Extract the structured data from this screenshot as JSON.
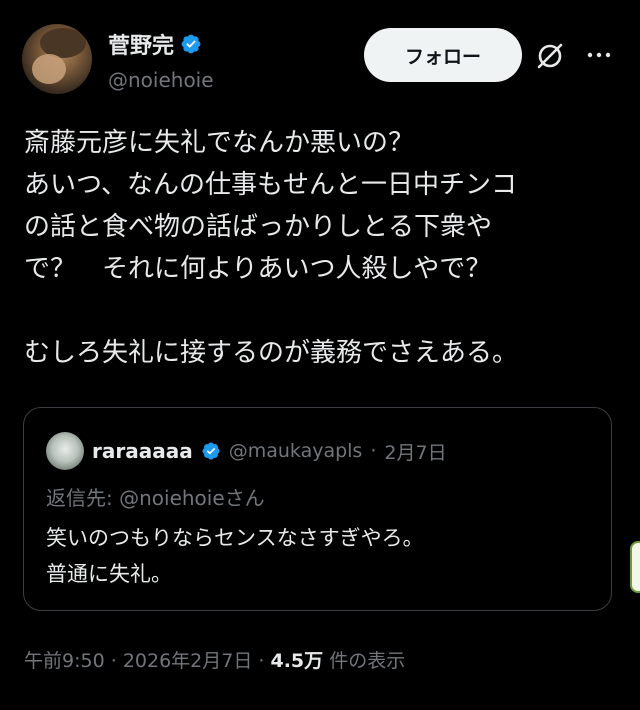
{
  "author": {
    "display_name": "菅野完",
    "handle": "@noiehoie",
    "verified": true,
    "avatar_icon": "user-avatar"
  },
  "actions": {
    "follow_label": "フォロー",
    "grok_icon": "grok-icon",
    "more_icon": "more-options-icon"
  },
  "tweet": {
    "lines": [
      "斎藤元彦に失礼でなんか悪いの？",
      "あいつ、なんの仕事もせんと一日中チンコ",
      "の話と食べ物の話ばっかりしとる下衆や",
      "で？　それに何よりあいつ人殺しやで？",
      "",
      "むしろ失礼に接するのが義務でさえある。"
    ]
  },
  "quote": {
    "display_name": "raraaaaa",
    "handle": "@maukayapls",
    "separator": "·",
    "date": "2月7日",
    "reply_to_prefix": "返信先: ",
    "reply_to_handle": "@noiehoie",
    "reply_to_suffix": "さん",
    "lines": [
      "笑いのつもりならセンスなさすぎやろ。",
      "普通に失礼。"
    ]
  },
  "meta": {
    "time": "午前9:50",
    "separator": "·",
    "date": "2026年2月7日",
    "views_count": "4.5万",
    "views_label": "件の表示"
  },
  "colors": {
    "background": "#000000",
    "text": "#e7e9ea",
    "secondary": "#71767b",
    "verified_blue": "#1d9bf0",
    "follow_bg": "#eff3f4",
    "border": "#3a3e42"
  }
}
